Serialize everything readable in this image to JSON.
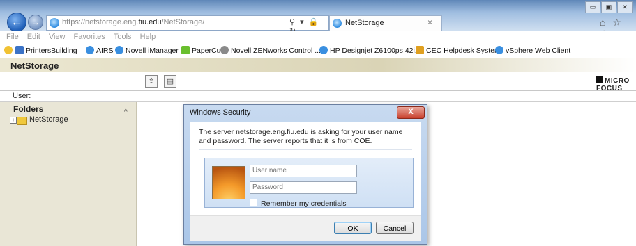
{
  "browser": {
    "url_prefix": "https://netstorage.eng.",
    "url_host": "fiu.edu",
    "url_path": "/NetStorage/",
    "address_actions": "⚲ ▾ 🔒 ↻",
    "tab_title": "NetStorage",
    "tab_close": "×",
    "window_controls": [
      "▭",
      "▣",
      "✕"
    ],
    "right_icons": "⌂ ☆ ⚙"
  },
  "menu": [
    "File",
    "Edit",
    "View",
    "Favorites",
    "Tools",
    "Help"
  ],
  "favorites": [
    {
      "label": "PrintersBuilding",
      "icon": "printer-icon",
      "color": "#3b73c7"
    },
    {
      "label": "AIRS",
      "icon": "ie-page-icon",
      "color": "#3a8fe0"
    },
    {
      "label": "Novell iManager",
      "icon": "ie-page-icon",
      "color": "#3a8fe0"
    },
    {
      "label": "PaperCut",
      "icon": "papercut-icon",
      "color": "#6abf2e"
    },
    {
      "label": "Novell ZENworks Control ...",
      "icon": "zenworks-icon",
      "color": "#8a8a8a"
    },
    {
      "label": "HP Designjet Z6100ps 42i...",
      "icon": "ie-page-icon",
      "color": "#3a8fe0"
    },
    {
      "label": "CEC Helpdesk System",
      "icon": "helpdesk-icon",
      "color": "#e0a020"
    },
    {
      "label": "vSphere Web Client",
      "icon": "ie-page-icon",
      "color": "#3a8fe0"
    }
  ],
  "app": {
    "title": "NetStorage",
    "toolbar_buttons": [
      "⇪",
      "▤"
    ],
    "brand": "MICRO FOCUS",
    "user_label": "User:"
  },
  "sidebar": {
    "heading": "Folders",
    "tree": [
      {
        "label": "NetStorage",
        "expander": "+"
      }
    ],
    "scroll_glyph": "^"
  },
  "dialog": {
    "title": "Windows Security",
    "close_label": "X",
    "message": "The server netstorage.eng.fiu.edu is asking for your user name and password. The server reports that it is from COE.",
    "username_placeholder": "User name",
    "password_placeholder": "Password",
    "remember_label": "Remember my credentials",
    "ok_label": "OK",
    "cancel_label": "Cancel"
  }
}
